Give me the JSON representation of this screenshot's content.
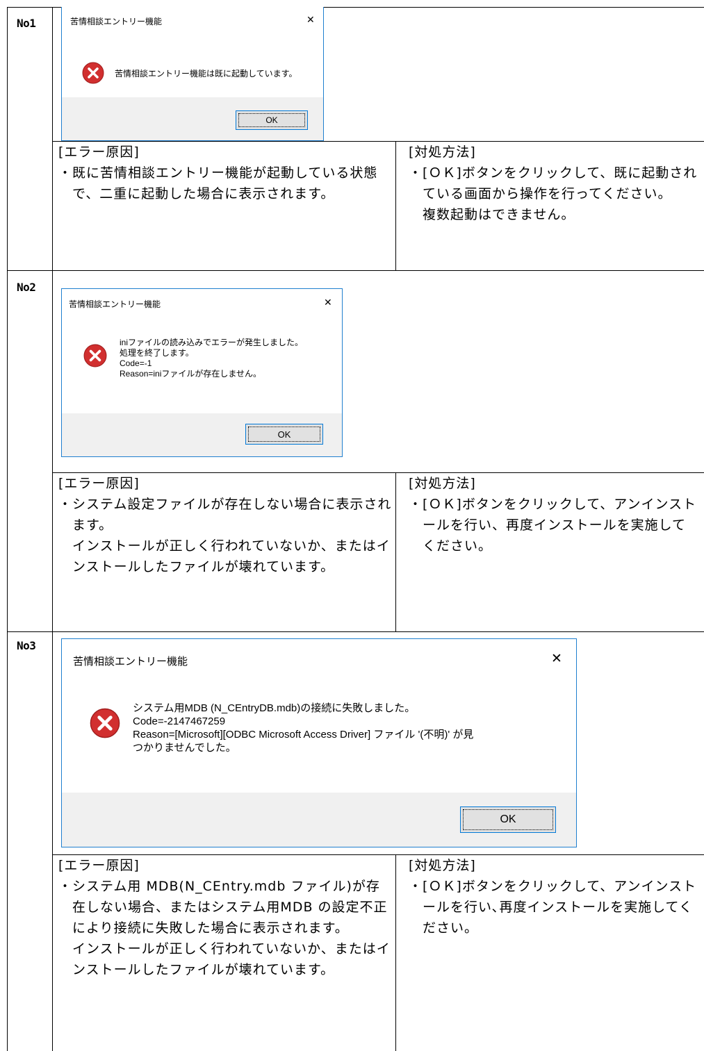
{
  "entries": [
    {
      "no": "No1",
      "dialog": {
        "title": "苦情相談エントリー機能",
        "close": "✕",
        "message": "苦情相談エントリー機能は既に起動しています。",
        "ok_label": "OK"
      },
      "cause_heading": "[エラー原因]",
      "cause_text": "・既に苦情相談エントリー機能が起動している状態で、二重に起動した場合に表示されます。",
      "remedy_heading": "[対処方法]",
      "remedy_text": "・[ＯＫ]ボタンをクリックして、既に起動されている画面から操作を行ってください。\n複数起動はできません。"
    },
    {
      "no": "No2",
      "dialog": {
        "title": "苦情相談エントリー機能",
        "close": "✕",
        "message": "iniファイルの読み込みでエラーが発生しました。\n処理を終了します。\nCode=-1\nReason=iniファイルが存在しません。",
        "ok_label": "OK"
      },
      "cause_heading": "[エラー原因]",
      "cause_text": "・システム設定ファイルが存在しない場合に表示されます。\nインストールが正しく行われていないか、またはインストールしたファイルが壊れています。",
      "remedy_heading": "[対処方法]",
      "remedy_text": "・[ＯＫ]ボタンをクリックして、アンインストールを行い、再度インストールを実施してください。"
    },
    {
      "no": "No3",
      "dialog": {
        "title": "苦情相談エントリー機能",
        "close": "✕",
        "message": "システム用MDB (N_CEntryDB.mdb)の接続に失敗しました。\nCode=-2147467259\nReason=[Microsoft][ODBC Microsoft Access Driver] ファイル '(不明)' が見\nつかりませんでした。",
        "ok_label": "OK"
      },
      "cause_heading": "[エラー原因]",
      "cause_text": "・システム用 MDB(N_CEntry.mdb ファイル)が存在しない場合、またはシステム用MDB の設定不正により接続に失敗した場合に表示されます。\nインストールが正しく行われていないか、またはインストールしたファイルが壊れています。",
      "remedy_heading": "[対処方法]",
      "remedy_text": "・[ＯＫ]ボタンをクリックして、アンインストールを行い､再度インストールを実施してください。"
    }
  ],
  "colors": {
    "dialog_border": "#1f7fcf",
    "footer_bg": "#f0f0f0",
    "error_icon_fill": "#d12f2f",
    "button_border": "#0078d7"
  }
}
